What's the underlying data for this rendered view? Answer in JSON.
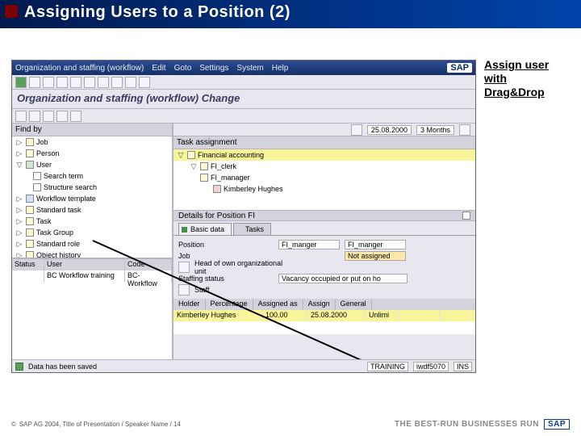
{
  "slide": {
    "title": "Assigning Users to a Position (2)"
  },
  "callout": {
    "l1": "Assign user",
    "l2": "with",
    "l3": "Drag&Drop"
  },
  "menubar": {
    "org": "Organization and staffing (workflow)",
    "edit": "Edit",
    "goto": "Goto",
    "settings": "Settings",
    "system": "System",
    "help": "Help",
    "logo": "SAP"
  },
  "subtitle": "Organization and staffing (workflow) Change",
  "datebar": {
    "date": "25.08.2000",
    "period": "3 Months"
  },
  "left": {
    "findby": "Find by",
    "nodes": [
      {
        "label": "Job"
      },
      {
        "label": "Person"
      },
      {
        "label": "User",
        "expanded": true,
        "children": [
          {
            "label": "Search term"
          },
          {
            "label": "Structure search"
          }
        ]
      },
      {
        "label": "Workflow template"
      },
      {
        "label": "Standard task"
      },
      {
        "label": "Task"
      },
      {
        "label": "Task Group"
      },
      {
        "label": "Standard role"
      },
      {
        "label": "Object history"
      }
    ],
    "grid": {
      "headers": {
        "a": "Status",
        "b": "User",
        "c": "Code"
      },
      "row": {
        "b": "BC Workflow training",
        "c": "BC-Workflow"
      }
    }
  },
  "right": {
    "task_hdr": "Task assignment",
    "tree": [
      {
        "label": "Financial accounting",
        "sel": true
      },
      {
        "label": "FI_clerk",
        "indent": 1
      },
      {
        "label": "FI_manager",
        "indent": 1
      },
      {
        "label": "Kimberley Hughes",
        "indent": 2
      }
    ],
    "details_hdr": "Details for Position FI",
    "tabs": {
      "basic": "Basic data",
      "tasks": "Tasks"
    },
    "form": {
      "position_lbl": "Position",
      "position_a": "FI_manger",
      "position_b": "FI_manger",
      "job_lbl": "Job",
      "job_val": "Not assigned",
      "head_lbl": "Head of own organizational unit",
      "staffing_lbl": "Staffing status",
      "staffing_val": "Vacancy occupied or put on ho",
      "staff_lbl": "Staff"
    },
    "holder_tabs": {
      "a": "Holder",
      "b": "Percentage",
      "c": "Assigned as",
      "d": "Assign",
      "e": "General"
    },
    "holder_row": {
      "name": "Kimberley Hughes",
      "pct": "100.00",
      "date": "25.08.2000",
      "col4": "Unlimi"
    }
  },
  "statusbar": {
    "msg": "Data has been saved",
    "sys": "TRAINING",
    "client": "iwdf5070",
    "mode": "INS"
  },
  "footer": "SAP AG 2004, Title of Presentation / Speaker Name / 14",
  "brand": "THE BEST-RUN BUSINESSES RUN"
}
